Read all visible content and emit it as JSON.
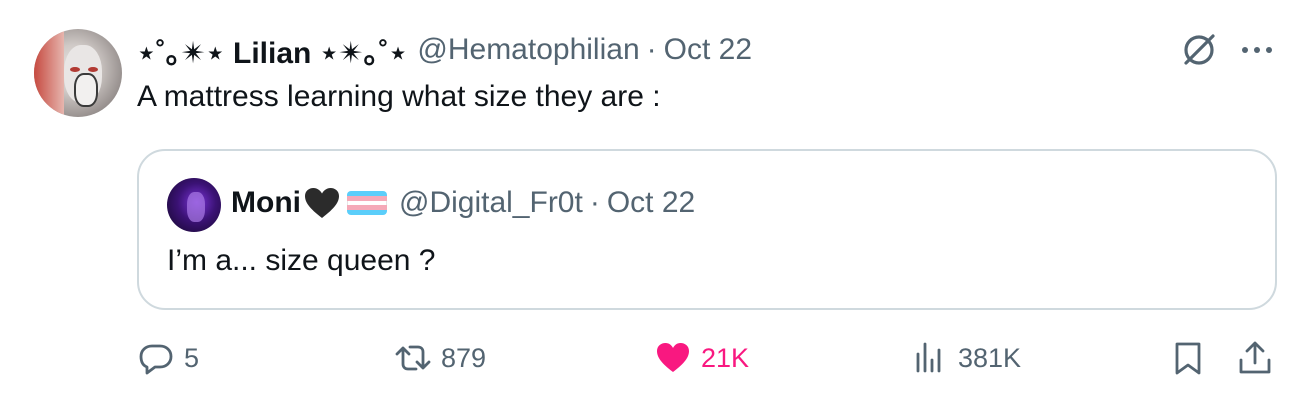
{
  "author": {
    "display_name": "⋆˚｡✴︎⋆ Lilian ⋆✴︎｡˚⋆",
    "handle": "@Hematophilian",
    "separator": "·",
    "date": "Oct 22"
  },
  "tweet": {
    "text": "A mattress learning what size they are :"
  },
  "quoted": {
    "display_name": "Moni",
    "emoji": [
      "black-heart",
      "transgender-flag"
    ],
    "handle": "@Digital_Fr0t",
    "separator": "·",
    "date": "Oct 22",
    "text": "I’m a... size queen ?"
  },
  "actions": {
    "replies": "5",
    "reposts": "879",
    "likes": "21K",
    "views": "381K"
  },
  "icons": [
    "grok-icon",
    "more-icon",
    "reply-icon",
    "retweet-icon",
    "heart-icon",
    "views-icon",
    "bookmark-icon",
    "share-icon"
  ],
  "colors": {
    "text": "#0f1419",
    "secondary": "#536471",
    "like": "#f91880",
    "border": "#cfd9de",
    "flag_blue": "#5bcefa",
    "flag_pink": "#f5a9b8",
    "flag_white": "#ffffff"
  }
}
